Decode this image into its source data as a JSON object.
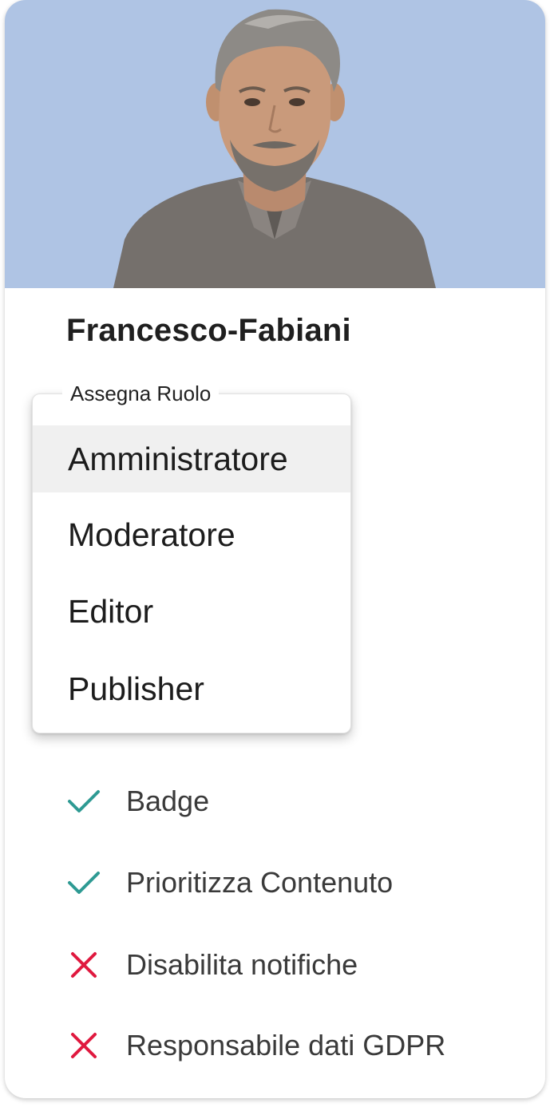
{
  "profile": {
    "name": "Francesco-Fabiani",
    "hero_bg": "#afc4e4"
  },
  "role_menu": {
    "label": "Assegna Ruolo",
    "selected": "Amministratore",
    "options": [
      "Amministratore",
      "Moderatore",
      "Editor",
      "Publisher"
    ]
  },
  "permissions": [
    {
      "label": "Badge",
      "enabled": true,
      "icon": "check-icon",
      "color": "#2e9a93"
    },
    {
      "label": "Prioritizza Contenuto",
      "enabled": true,
      "icon": "check-icon",
      "color": "#2e9a93"
    },
    {
      "label": "Disabilita notifiche",
      "enabled": false,
      "icon": "cross-icon",
      "color": "#e0193f"
    },
    {
      "label": "Responsabile dati GDPR",
      "enabled": false,
      "icon": "cross-icon",
      "color": "#e0193f"
    }
  ]
}
